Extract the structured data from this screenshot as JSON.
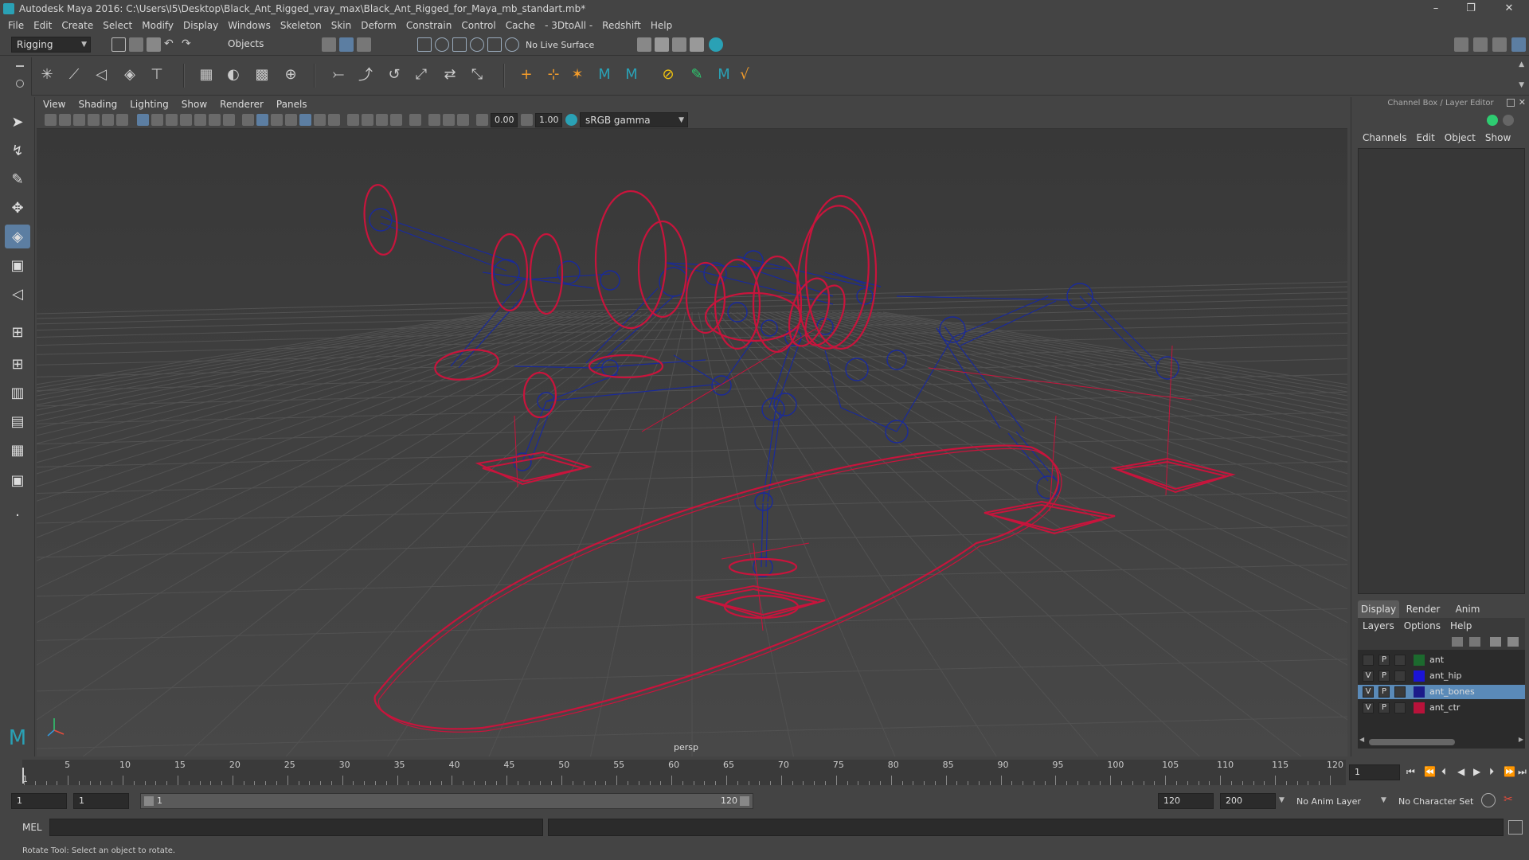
{
  "title": "Autodesk Maya 2016: C:\\Users\\I5\\Desktop\\Black_Ant_Rigged_vray_max\\Black_Ant_Rigged_for_Maya_mb_standart.mb*",
  "menu": [
    "File",
    "Edit",
    "Create",
    "Select",
    "Modify",
    "Display",
    "Windows",
    "Skeleton",
    "Skin",
    "Deform",
    "Constrain",
    "Control",
    "Cache",
    "- 3DtoAll -",
    "Redshift",
    "Help"
  ],
  "status": {
    "menuset": "Rigging",
    "selection_mode": "Objects",
    "live_surface": "No Live Surface"
  },
  "panel_menu": [
    "View",
    "Shading",
    "Lighting",
    "Show",
    "Renderer",
    "Panels"
  ],
  "panel_toolbar": {
    "field1": "0.00",
    "field2": "1.00",
    "colorspace": "sRGB gamma"
  },
  "viewport": {
    "camera": "persp"
  },
  "channel_box": {
    "title": "Channel Box / Layer Editor",
    "menu": [
      "Channels",
      "Edit",
      "Object",
      "Show"
    ],
    "tabs": [
      "Display",
      "Render",
      "Anim"
    ],
    "active_tab": "Display",
    "layer_menu": [
      "Layers",
      "Options",
      "Help"
    ],
    "layers": [
      {
        "v": "",
        "p": "P",
        "name": "ant",
        "color": "#1c6a2e"
      },
      {
        "v": "V",
        "p": "P",
        "name": "ant_hip",
        "color": "#1b14d6"
      },
      {
        "v": "V",
        "p": "P",
        "name": "ant_bones",
        "color": "#1c1c8a"
      },
      {
        "v": "V",
        "p": "P",
        "name": "ant_ctr",
        "color": "#b8123a"
      }
    ],
    "selected_layer": "ant_bones"
  },
  "timeline": {
    "ticks": [
      "5",
      "10",
      "15",
      "20",
      "25",
      "30",
      "35",
      "40",
      "45",
      "50",
      "55",
      "60",
      "65",
      "70",
      "75",
      "80",
      "85",
      "90",
      "95",
      "100",
      "105",
      "110",
      "115",
      "120"
    ],
    "start_marker": "1",
    "current_frame": "1"
  },
  "range": {
    "start": "1",
    "playback_start": "1",
    "slider_start": "1",
    "slider_end": "120",
    "playback_end": "120",
    "end": "200",
    "anim_layer": "No Anim Layer",
    "character_set": "No Character Set"
  },
  "cmdline": {
    "label": "MEL"
  },
  "help_text": "Rotate Tool: Select an object to rotate.",
  "colors": {
    "bg": "#444444",
    "viewport": "#3c3c3c",
    "rig_red": "#c8143c",
    "rig_blue": "#1a2a9a",
    "accent": "#5a8ab8"
  }
}
